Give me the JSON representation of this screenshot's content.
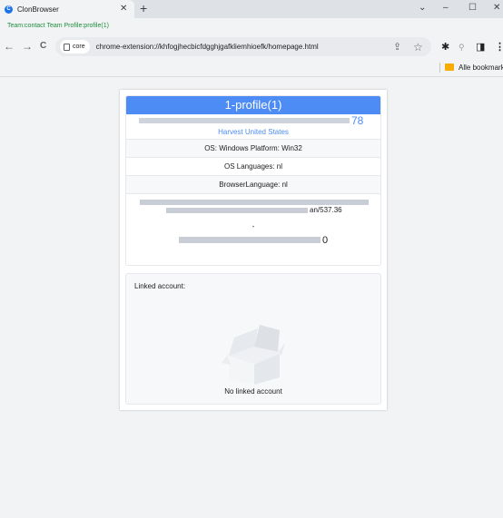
{
  "tab": {
    "favicon_glyph": "C",
    "title": "ClonBrowser",
    "close_glyph": "✕"
  },
  "new_tab_glyph": "+",
  "window_controls": {
    "dropdown_glyph": "⌄",
    "minimize_glyph": "–",
    "maximize_glyph": "☐",
    "close_glyph": "✕"
  },
  "teambar": {
    "text": "Team:contact Team Profile:profile(1)"
  },
  "toolbar": {
    "back_glyph": "←",
    "forward_glyph": "→",
    "reload_glyph": "C",
    "chip_label": "core",
    "url": "chrome-extension://khfogjhecbicfdgghjgafkliemhioefk/homepage.html",
    "share_glyph": "⇪",
    "star_glyph": "☆",
    "extensions_glyph": "✱",
    "search_glyph": "⚲",
    "sidepanel_glyph": "◨",
    "menu_glyph": "⋮"
  },
  "bookmarks": {
    "label": "Alle bookmarks"
  },
  "profile": {
    "header": "1-profile(1)",
    "ip_tail": "78",
    "location": "Harvest United States",
    "os": "OS: Windows Platform: Win32",
    "os_languages": "OS Languages: nl",
    "browser_language": "BrowserLanguage: nl",
    "ua_tail": "an/537.36",
    "ua_dash": "-",
    "last_tail": "0"
  },
  "linked": {
    "title": "Linked account:",
    "empty_text": "No linked account"
  },
  "colors": {
    "accent": "#4d8bf5",
    "team_text": "#1e8e3e",
    "bookmark_folder": "#f9ab00"
  }
}
